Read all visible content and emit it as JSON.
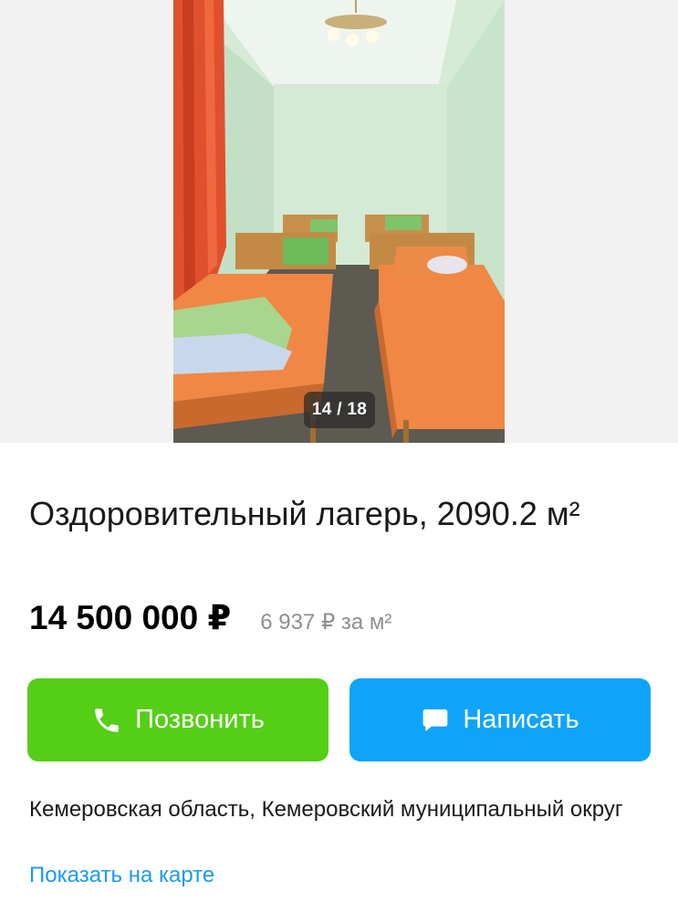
{
  "gallery": {
    "counter": "14 / 18",
    "current_index": 14,
    "total": 18
  },
  "listing": {
    "title": "Оздоровительный лагерь, 2090.2 м²",
    "price": "14 500 000 ₽",
    "price_per_m2": "6 937 ₽ за м²"
  },
  "actions": {
    "call_label": "Позвонить",
    "message_label": "Написать",
    "call_icon": "phone-icon",
    "message_icon": "chat-bubble-icon",
    "call_color": "#55cf16",
    "message_color": "#10a4f9"
  },
  "location": {
    "address": "Кемеровская область, Кемеровский муниципальный округ",
    "map_link": "Показать на карте",
    "link_color": "#1a9bf0"
  }
}
